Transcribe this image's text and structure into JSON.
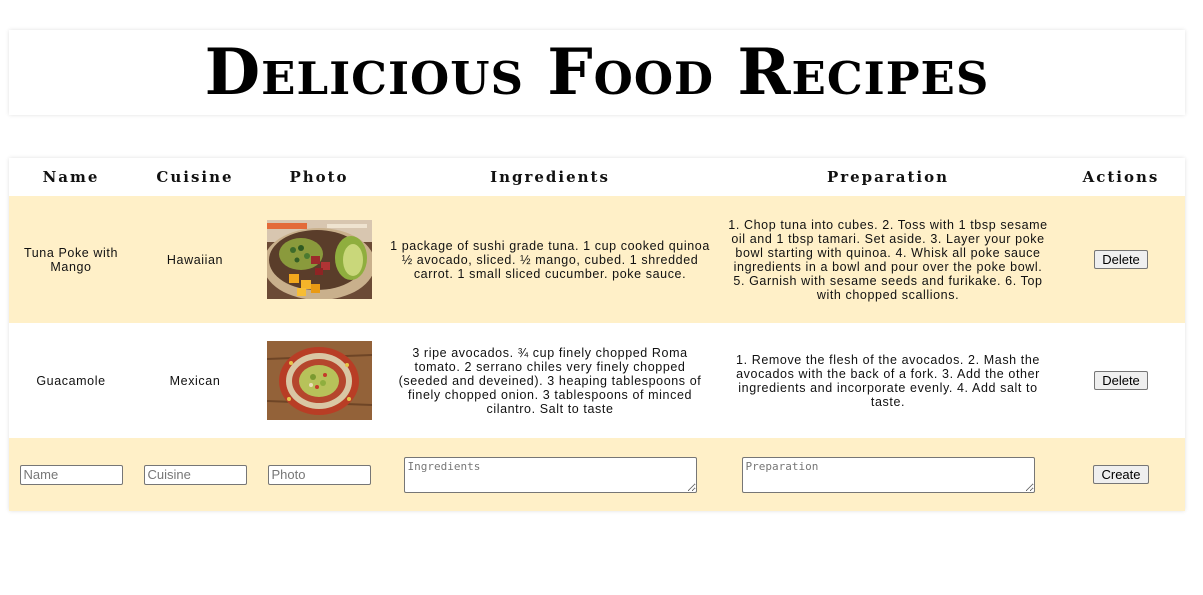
{
  "header": {
    "title": "Delicious Food Recipes"
  },
  "table": {
    "columns": [
      "Name",
      "Cuisine",
      "Photo",
      "Ingredients",
      "Preparation",
      "Actions"
    ],
    "rows": [
      {
        "name": "Tuna Poke with Mango",
        "cuisine": "Hawaiian",
        "photo_icon": "poke-bowl-photo",
        "ingredients": "1 package of sushi grade tuna. 1 cup cooked quinoa ½ avocado, sliced. ½ mango, cubed. 1 shredded carrot. 1 small sliced cucumber. poke sauce.",
        "preparation": "1. Chop tuna into cubes. 2. Toss with 1 tbsp sesame oil and 1 tbsp tamari. Set aside. 3. Layer your poke bowl starting with quinoa. 4. Whisk all poke sauce ingredients in a bowl and pour over the poke bowl. 5. Garnish with sesame seeds and furikake. 6. Top with chopped scallions.",
        "action_label": "Delete"
      },
      {
        "name": "Guacamole",
        "cuisine": "Mexican",
        "photo_icon": "guacamole-photo",
        "ingredients": "3 ripe avocados. ¾ cup finely chopped Roma tomato. 2 serrano chiles very finely chopped (seeded and deveined). 3 heaping tablespoons of finely chopped onion. 3 tablespoons of minced cilantro. Salt to taste",
        "preparation": "1. Remove the flesh of the avocados. 2. Mash the avocados with the back of a fork. 3. Add the other ingredients and incorporate evenly. 4. Add salt to taste.",
        "action_label": "Delete"
      }
    ],
    "form": {
      "name_placeholder": "Name",
      "cuisine_placeholder": "Cuisine",
      "photo_placeholder": "Photo",
      "ingredients_placeholder": "Ingredients",
      "preparation_placeholder": "Preparation",
      "create_label": "Create"
    }
  },
  "colors": {
    "row_highlight": "#fff0c8",
    "background": "#ffffff"
  }
}
